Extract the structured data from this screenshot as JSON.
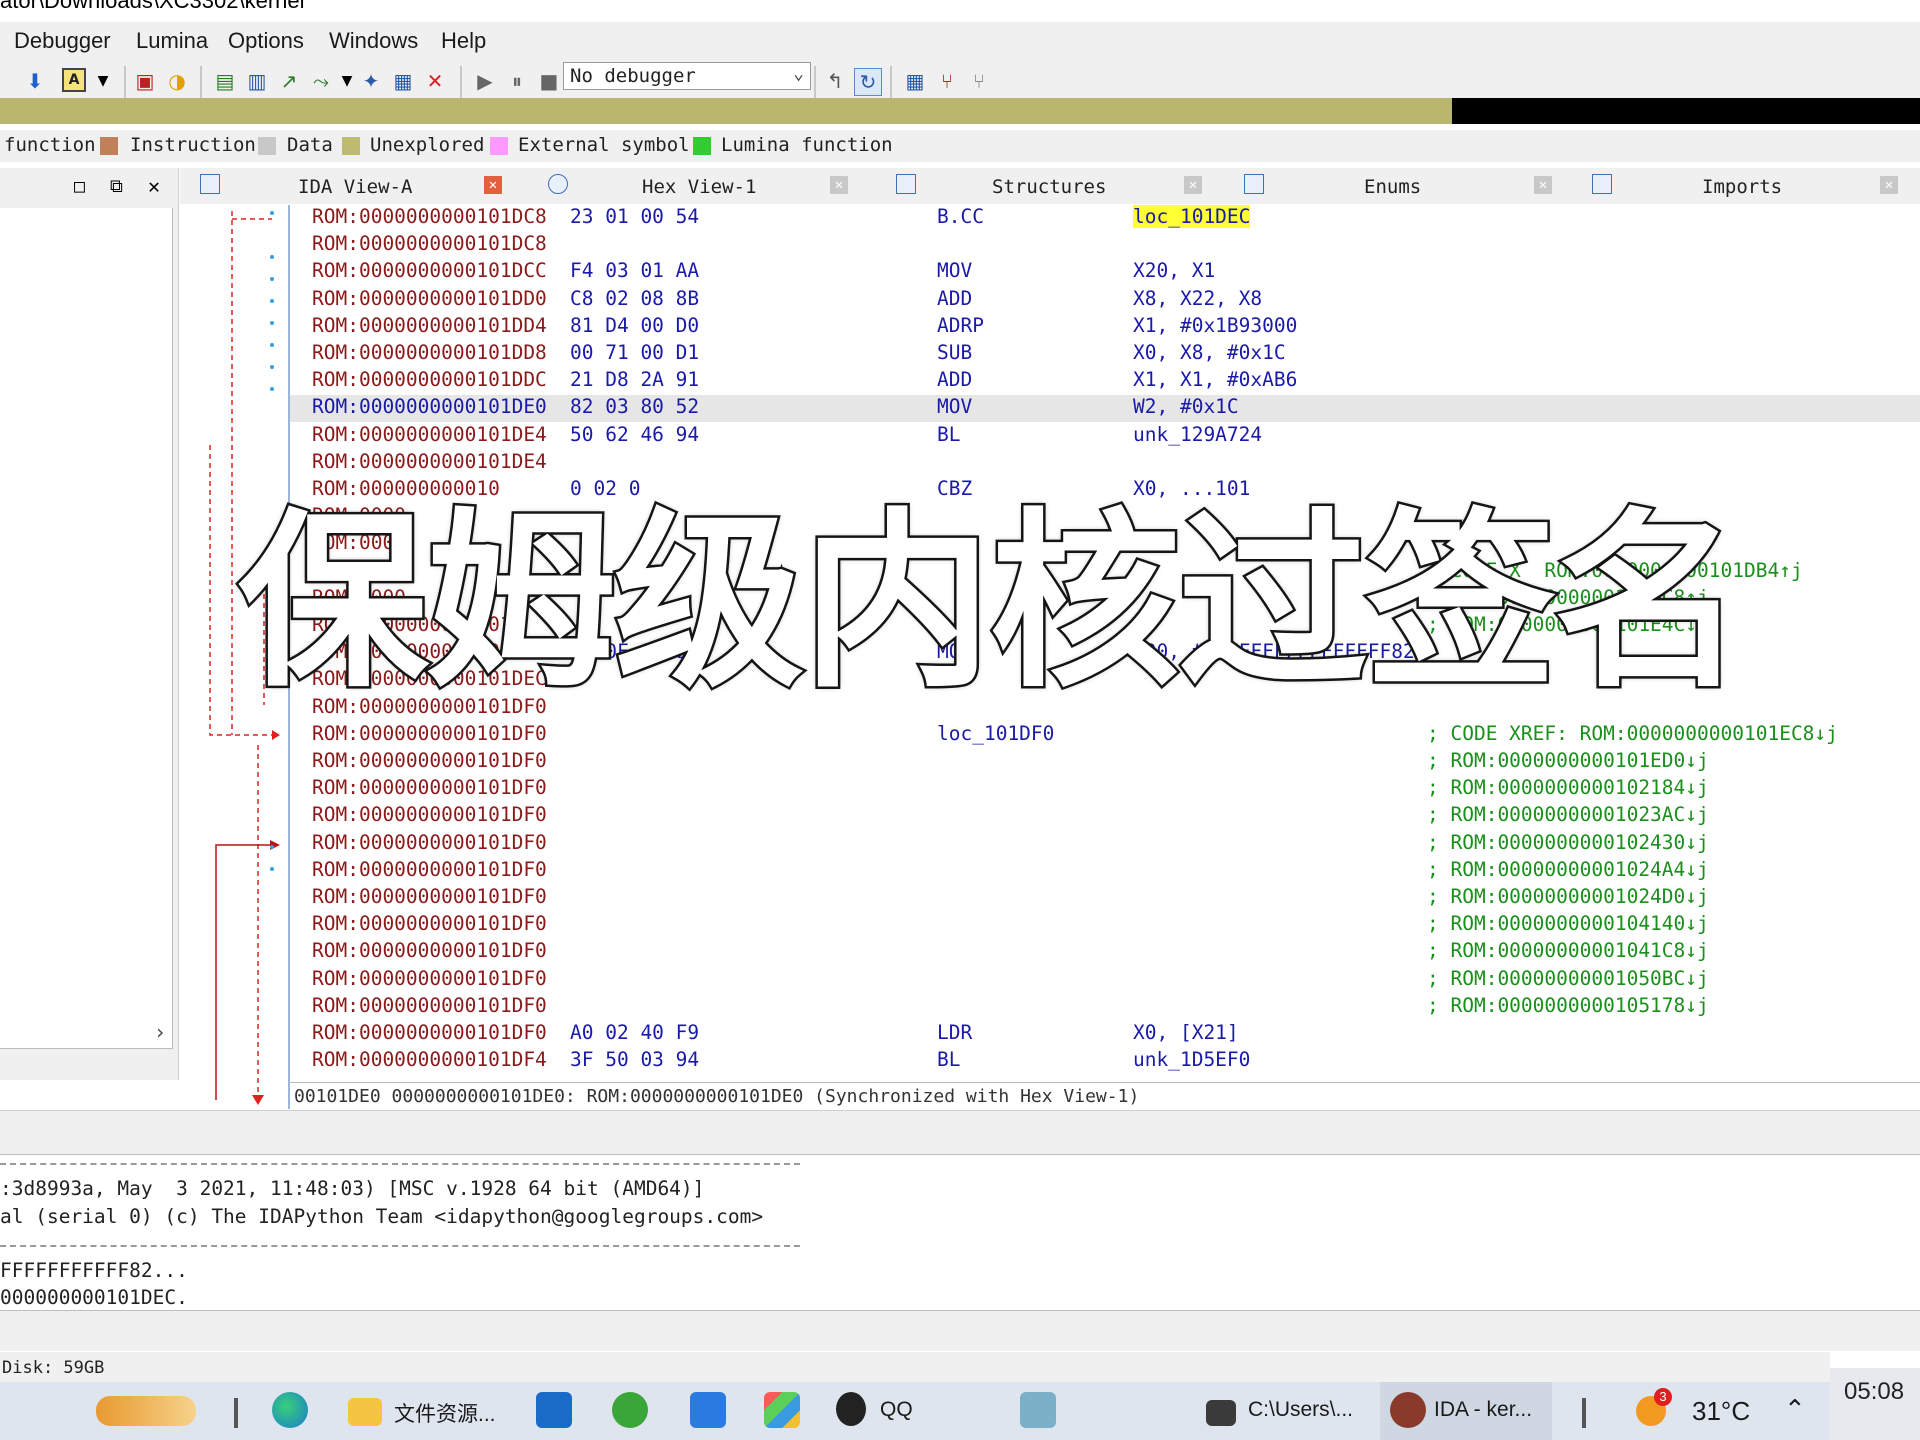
{
  "window": {
    "title_fragment": "ator\\Downloads\\XC3302\\kernel"
  },
  "menu": [
    "Debugger",
    "Lumina",
    "Options",
    "Windows",
    "Help"
  ],
  "toolbar": {
    "debugger_select": "No debugger"
  },
  "legend": [
    {
      "label": "function",
      "color": ""
    },
    {
      "label": "Instruction",
      "color": "#c0805a"
    },
    {
      "label": "Data",
      "color": "#c8c8c8"
    },
    {
      "label": "Unexplored",
      "color": "#bdbb70"
    },
    {
      "label": "External symbol",
      "color": "#ff99ff"
    },
    {
      "label": "Lumina function",
      "color": "#33cc33"
    }
  ],
  "tabs": [
    {
      "label": "IDA View-A"
    },
    {
      "label": "Hex View-1"
    },
    {
      "label": "Structures"
    },
    {
      "label": "Enums"
    },
    {
      "label": "Imports"
    }
  ],
  "disasm": [
    {
      "addr": "ROM:0000000000101DC8",
      "bytes": "23 01 00 54",
      "mnemonic": "B.CC",
      "operands": "loc_101DEC",
      "comment": "",
      "op_highlight": true
    },
    {
      "addr": "ROM:0000000000101DC8",
      "bytes": "",
      "mnemonic": "",
      "operands": "",
      "comment": ""
    },
    {
      "addr": "ROM:0000000000101DCC",
      "bytes": "F4 03 01 AA",
      "mnemonic": "MOV",
      "operands": "X20, X1",
      "comment": ""
    },
    {
      "addr": "ROM:0000000000101DD0",
      "bytes": "C8 02 08 8B",
      "mnemonic": "ADD",
      "operands": "X8, X22, X8",
      "comment": ""
    },
    {
      "addr": "ROM:0000000000101DD4",
      "bytes": "81 D4 00 D0",
      "mnemonic": "ADRP",
      "operands": "X1, #0x1B93000",
      "comment": ""
    },
    {
      "addr": "ROM:0000000000101DD8",
      "bytes": "00 71 00 D1",
      "mnemonic": "SUB",
      "operands": "X0, X8, #0x1C",
      "comment": ""
    },
    {
      "addr": "ROM:0000000000101DDC",
      "bytes": "21 D8 2A 91",
      "mnemonic": "ADD",
      "operands": "X1, X1, #0xAB6",
      "comment": ""
    },
    {
      "addr": "ROM:0000000000101DE0",
      "bytes": "82 03 80 52",
      "mnemonic": "MOV",
      "operands": "W2, #0x1C",
      "comment": "",
      "highlight": true
    },
    {
      "addr": "ROM:0000000000101DE4",
      "bytes": "50 62 46 94",
      "mnemonic": "BL",
      "operands": "unk_129A724",
      "comment": ""
    },
    {
      "addr": "ROM:0000000000101DE4",
      "bytes": "",
      "mnemonic": "",
      "operands": "",
      "comment": ""
    },
    {
      "addr": "ROM:000000000010",
      "bytes": "0 02 0",
      "mnemonic": "CBZ",
      "operands": "X0, ...101",
      "comment": ""
    },
    {
      "addr": "ROM:0000",
      "bytes": "",
      "mnemonic": "",
      "operands": "",
      "comment": ""
    },
    {
      "addr": "ROM:0000",
      "bytes": "",
      "mnemonic": "",
      "operands": "",
      "comment": ""
    },
    {
      "addr": "",
      "bytes": "",
      "mnemonic": "",
      "operands": "",
      "comment": "; CODE X  ROM:0000000000101DB4↑j"
    },
    {
      "addr": "ROM:0000",
      "bytes": "",
      "mnemonic": "",
      "operands": "",
      "comment": "; ROM:0000000000101DC8↑j"
    },
    {
      "addr": "ROM:0000000000101D",
      "bytes": "",
      "mnemonic": "",
      "operands": "",
      "comment": "; ROM:0000000000101E4C↓j"
    },
    {
      "addr": "ROM:0000000000101DEC",
      "bytes": "B4 0F 80 92",
      "mnemonic": "MOV",
      "operands": "X20, #0xFFFFFFFFFFFFFF82",
      "comment": ""
    },
    {
      "addr": "ROM:0000000000101DEC",
      "bytes": "",
      "mnemonic": "",
      "operands": "",
      "comment": ""
    },
    {
      "addr": "ROM:0000000000101DF0",
      "bytes": "",
      "mnemonic": "",
      "operands": "",
      "comment": ""
    },
    {
      "addr": "ROM:0000000000101DF0",
      "bytes": "",
      "mnemonic": "loc_101DF0",
      "operands": "",
      "comment": "; CODE XREF: ROM:0000000000101EC8↓j"
    },
    {
      "addr": "ROM:0000000000101DF0",
      "bytes": "",
      "mnemonic": "",
      "operands": "",
      "comment": "; ROM:0000000000101ED0↓j"
    },
    {
      "addr": "ROM:0000000000101DF0",
      "bytes": "",
      "mnemonic": "",
      "operands": "",
      "comment": "; ROM:0000000000102184↓j"
    },
    {
      "addr": "ROM:0000000000101DF0",
      "bytes": "",
      "mnemonic": "",
      "operands": "",
      "comment": "; ROM:00000000001023AC↓j"
    },
    {
      "addr": "ROM:0000000000101DF0",
      "bytes": "",
      "mnemonic": "",
      "operands": "",
      "comment": "; ROM:0000000000102430↓j"
    },
    {
      "addr": "ROM:0000000000101DF0",
      "bytes": "",
      "mnemonic": "",
      "operands": "",
      "comment": "; ROM:00000000001024A4↓j"
    },
    {
      "addr": "ROM:0000000000101DF0",
      "bytes": "",
      "mnemonic": "",
      "operands": "",
      "comment": "; ROM:00000000001024D0↓j"
    },
    {
      "addr": "ROM:0000000000101DF0",
      "bytes": "",
      "mnemonic": "",
      "operands": "",
      "comment": "; ROM:0000000000104140↓j"
    },
    {
      "addr": "ROM:0000000000101DF0",
      "bytes": "",
      "mnemonic": "",
      "operands": "",
      "comment": "; ROM:00000000001041C8↓j"
    },
    {
      "addr": "ROM:0000000000101DF0",
      "bytes": "",
      "mnemonic": "",
      "operands": "",
      "comment": "; ROM:00000000001050BC↓j"
    },
    {
      "addr": "ROM:0000000000101DF0",
      "bytes": "",
      "mnemonic": "",
      "operands": "",
      "comment": "; ROM:0000000000105178↓j"
    },
    {
      "addr": "ROM:0000000000101DF0",
      "bytes": "A0 02 40 F9",
      "mnemonic": "LDR",
      "operands": "X0, [X21]",
      "comment": ""
    },
    {
      "addr": "ROM:0000000000101DF4",
      "bytes": "3F 50 03 94",
      "mnemonic": "BL",
      "operands": "unk_1D5EF0",
      "comment": ""
    }
  ],
  "sync_status": "00101DE0 0000000000101DE0: ROM:0000000000101DE0 (Synchronized with Hex View-1)",
  "overlay_text": "保姆级内核过签名",
  "output": {
    "line1": ":3d8993a, May  3 2021, 11:48:03) [MSC v.1928 64 bit (AMD64)]",
    "line2": "al (serial 0) (c) The IDAPython Team <idapython@googlegroups.com>",
    "line3": "FFFFFFFFFFF82...",
    "line4": "000000000101DEC."
  },
  "status": {
    "disk": "Disk: 59GB"
  },
  "taskbar": {
    "explorer_label": "文件资源...",
    "qq_label": "QQ",
    "cmd_label": "C:\\Users\\...",
    "ida_label": "IDA - ker...",
    "temperature": "31°C",
    "weather_badge": "3",
    "time": "05:08"
  }
}
